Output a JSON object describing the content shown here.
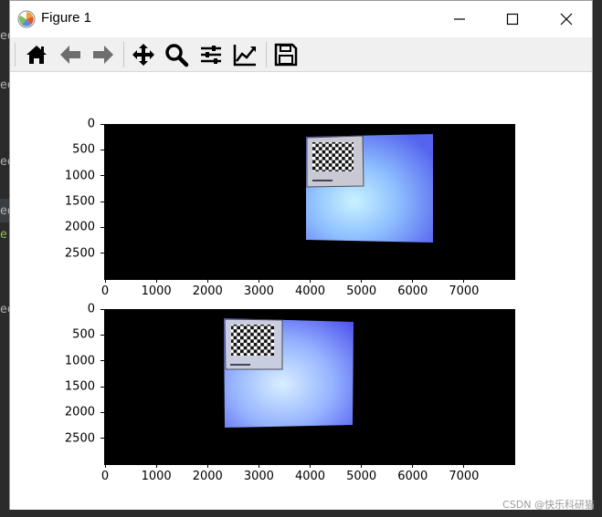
{
  "window": {
    "title": "Figure 1",
    "minimize_glyph": "minimize-icon",
    "maximize_glyph": "maximize-icon",
    "close_glyph": "close-icon"
  },
  "toolbar": {
    "buttons": [
      {
        "icon": "home-icon"
      },
      {
        "icon": "back-arrow-icon"
      },
      {
        "icon": "forward-arrow-icon"
      },
      {
        "icon": "pan-move-icon"
      },
      {
        "icon": "zoom-magnifier-icon"
      },
      {
        "icon": "configure-subplots-icon"
      },
      {
        "icon": "edit-axes-icon"
      },
      {
        "icon": "save-figure-icon"
      }
    ]
  },
  "background_fragments": [
    "ed",
    "ed",
    "ed",
    "ed",
    "e",
    "ed"
  ],
  "watermark": "CSDN @快乐科研猫",
  "chart_data": [
    {
      "type": "image",
      "xticks": [
        "0",
        "1000",
        "2000",
        "3000",
        "4000",
        "5000",
        "6000",
        "7000"
      ],
      "yticks": [
        "0",
        "500",
        "1000",
        "1500",
        "2000",
        "2500"
      ],
      "xlim": [
        0,
        8000
      ],
      "ylim": [
        3000,
        0
      ],
      "content": "black background with a bright blue lit sheet holding a checkerboard calibration pattern",
      "sheet_corners": [
        [
          3950,
          250
        ],
        [
          6400,
          200
        ],
        [
          6400,
          2300
        ],
        [
          3950,
          2250
        ]
      ],
      "pattern_corners": [
        [
          3950,
          250
        ],
        [
          5050,
          250
        ],
        [
          5050,
          1200
        ],
        [
          3950,
          1200
        ]
      ],
      "background_color": "#000000",
      "sheet_color": "#7fa8ff"
    },
    {
      "type": "image",
      "xticks": [
        "0",
        "1000",
        "2000",
        "3000",
        "4000",
        "5000",
        "6000",
        "7000"
      ],
      "yticks": [
        "0",
        "500",
        "1000",
        "1500",
        "2000",
        "2500"
      ],
      "xlim": [
        0,
        8000
      ],
      "ylim": [
        3000,
        0
      ],
      "content": "black background with a bright blue lit sheet holding a checkerboard calibration pattern",
      "sheet_corners": [
        [
          2300,
          200
        ],
        [
          4850,
          250
        ],
        [
          4850,
          2300
        ],
        [
          2300,
          2350
        ]
      ],
      "pattern_corners": [
        [
          2300,
          200
        ],
        [
          3450,
          200
        ],
        [
          3450,
          1200
        ],
        [
          2300,
          1200
        ]
      ],
      "background_color": "#000000",
      "sheet_color": "#7b96ff"
    }
  ]
}
